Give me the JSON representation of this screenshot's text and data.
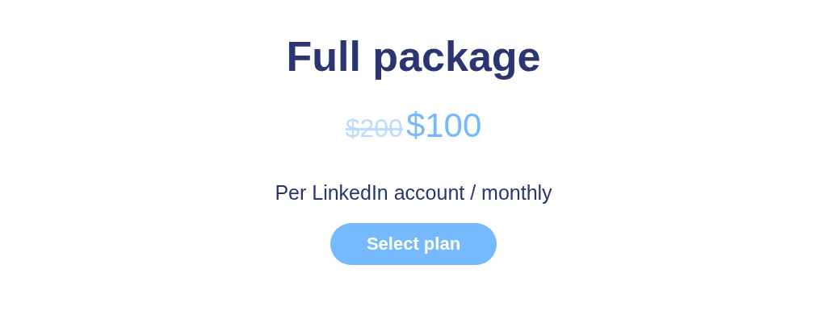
{
  "plan": {
    "title": "Full package",
    "old_price": "$200",
    "price": "$100",
    "billing": "Per LinkedIn account / monthly",
    "button": "Select plan"
  }
}
